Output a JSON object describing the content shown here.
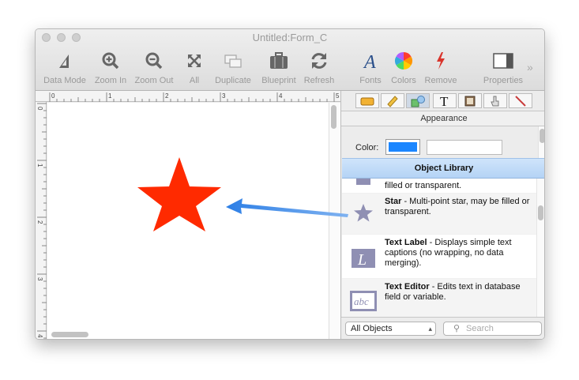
{
  "window": {
    "title": "Untitled:Form_C"
  },
  "toolbar": {
    "data_mode": "Data Mode",
    "zoom_in": "Zoom In",
    "zoom_out": "Zoom Out",
    "all": "All",
    "duplicate": "Duplicate",
    "blueprint": "Blueprint",
    "refresh": "Refresh",
    "fonts": "Fonts",
    "colors": "Colors",
    "remove": "Remove",
    "properties": "Properties",
    "overflow": "»"
  },
  "ruler": {
    "top_labels": [
      "0",
      "1",
      "2",
      "3",
      "4",
      "5"
    ],
    "left_labels": [
      "0",
      "1",
      "2",
      "3",
      "4"
    ]
  },
  "panel": {
    "appearance_label": "Appearance",
    "color_label": "Color:",
    "color_value": "#1b86ff",
    "library_title": "Object Library",
    "items": [
      {
        "desc": "filled or transparent."
      },
      {
        "name": "Star",
        "desc": " - Multi-point star, may be filled or transparent."
      },
      {
        "name": "Text Label",
        "desc": " - Displays simple text captions (no wrapping, no data merging)."
      },
      {
        "name": "Text Editor",
        "desc": " - Edits text in database field or variable."
      }
    ],
    "text_label_icon": "L",
    "text_editor_icon": "abc",
    "filter_select": "All Objects",
    "search_placeholder": "Search"
  },
  "canvas": {
    "star_color": "#ff2a00",
    "arrow_color": "#2d7fe6"
  }
}
